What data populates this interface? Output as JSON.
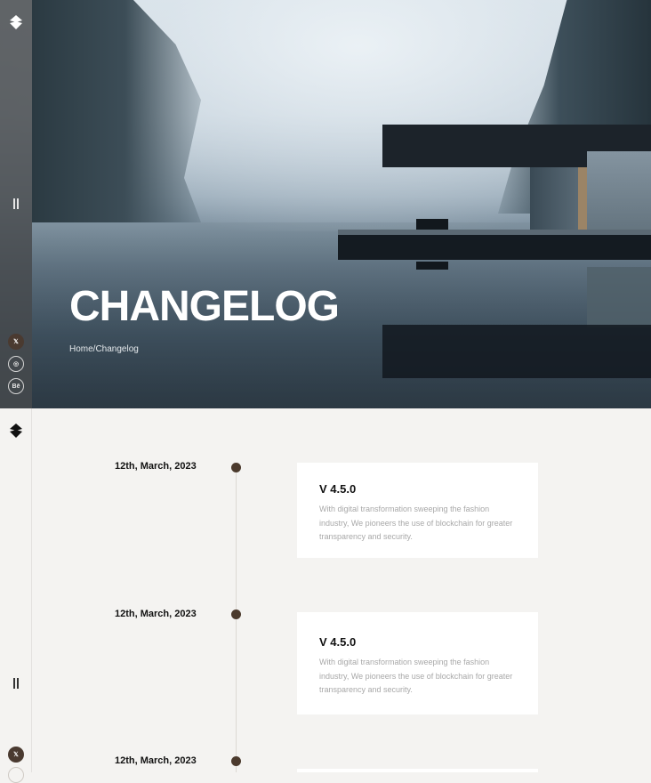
{
  "hero": {
    "title": "CHANGELOG",
    "breadcrumb": "Home/Changelog"
  },
  "sidebar": {
    "social": [
      "𝕏",
      "◎",
      "Bē"
    ]
  },
  "timeline": [
    {
      "date": "12th, March, 2023",
      "version": "V 4.5.0",
      "description": "With digital transformation sweeping the fashion industry, We pioneers the use of blockchain for greater transparency and security."
    },
    {
      "date": "12th, March, 2023",
      "version": "V 4.5.0",
      "description": "With digital transformation sweeping the fashion industry, We pioneers the use of blockchain for greater transparency and security."
    },
    {
      "date": "12th, March, 2023",
      "version": "",
      "description": ""
    }
  ],
  "colors": {
    "accent": "#4b3a2d",
    "background": "#f4f3f1",
    "sidebar_dark": "#46484a"
  }
}
